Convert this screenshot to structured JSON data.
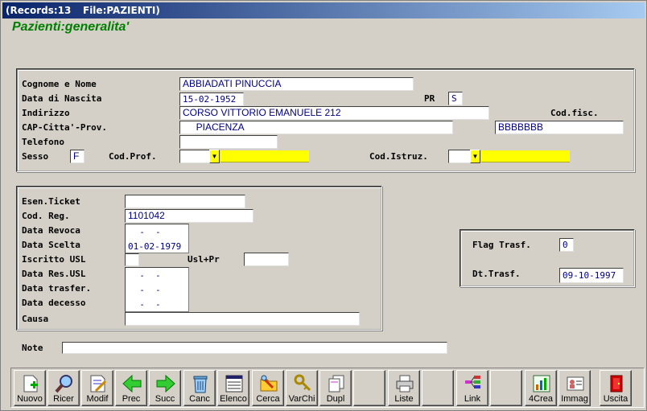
{
  "titlebar": {
    "records": "(Records:13",
    "file": "File:PAZIENTI)"
  },
  "form": {
    "title": "Pazienti:generalita'"
  },
  "labels": {
    "cognome": "Cognome e Nome",
    "nascita": "Data di Nascita",
    "pr": "PR",
    "indirizzo": "Indirizzo",
    "codfisc": "Cod.fisc.",
    "cap": "CAP-Citta'-Prov.",
    "telefono": "Telefono",
    "sesso": "Sesso",
    "codprof": "Cod.Prof.",
    "codistruz": "Cod.Istruz.",
    "esen": "Esen.Ticket",
    "codreg": "Cod. Reg.",
    "revoca": "Data Revoca",
    "scelta": "Data Scelta",
    "iscritto": "Iscritto USL",
    "uslpr": "Usl+Pr",
    "resusl": "Data Res.USL",
    "trasfer": "Data trasfer.",
    "decesso": "Data decesso",
    "causa": "Causa",
    "flag": "Flag Trasf.",
    "dttrasf": "Dt.Trasf.",
    "note": "Note"
  },
  "values": {
    "cognome": "ABBIADATI PINUCCIA",
    "nascita": "15-02-1952",
    "pr": "S",
    "indirizzo": "CORSO VITTORIO EMANUELE 212",
    "cap": "     PIACENZA",
    "codfisc": "BBBBBBB",
    "telefono": "",
    "sesso": "F",
    "codprof": "",
    "codistruz": "",
    "esen": "",
    "codreg": "1101042",
    "revoca": "  -  -",
    "scelta": "01-02-1979",
    "iscritto": "",
    "uslpr": "",
    "resusl": "  -  -",
    "trasfer": "  -  -",
    "decesso": "  -  -",
    "causa": "",
    "flag": "0",
    "dttrasf": "09-10-1997",
    "note": ""
  },
  "toolbar": [
    {
      "label": "Nuovo",
      "icon": "new-document-icon"
    },
    {
      "label": "Ricer",
      "icon": "magnifier-icon"
    },
    {
      "label": "Modif",
      "icon": "edit-document-icon"
    },
    {
      "label": "Prec",
      "icon": "arrow-left-icon"
    },
    {
      "label": "Succ",
      "icon": "arrow-right-icon"
    },
    {
      "label": "Canc",
      "icon": "trash-icon"
    },
    {
      "label": "Elenco",
      "icon": "list-icon"
    },
    {
      "label": "Cerca",
      "icon": "search-folder-icon"
    },
    {
      "label": "VarChi",
      "icon": "keys-icon"
    },
    {
      "label": "Dupl",
      "icon": "duplicate-icon"
    },
    {
      "label": "Liste",
      "icon": "printer-icon"
    },
    {
      "label": "Link",
      "icon": "link-icon"
    },
    {
      "label": "4Crea",
      "icon": "chart-icon"
    },
    {
      "label": "Immag",
      "icon": "id-card-icon"
    },
    {
      "label": "Uscita",
      "icon": "exit-door-icon"
    }
  ]
}
